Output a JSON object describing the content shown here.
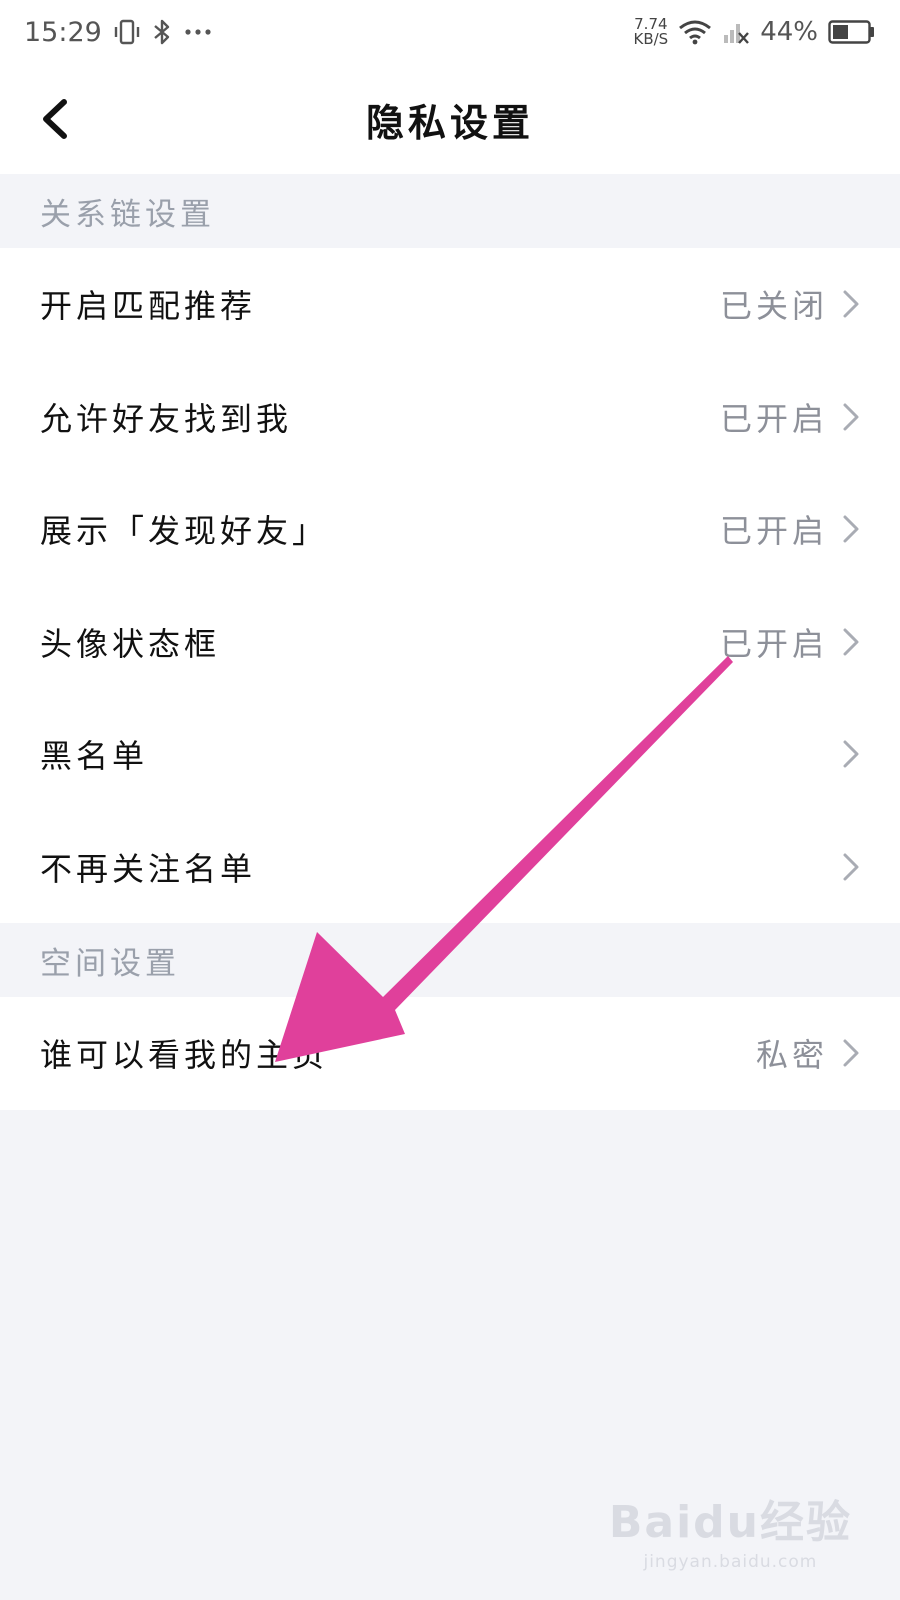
{
  "status_bar": {
    "time": "15:29",
    "net_speed_value": "7.74",
    "net_speed_unit": "KB/S",
    "battery": "44%",
    "icons": [
      "vibrate-icon",
      "bluetooth-icon",
      "more-dots-icon",
      "wifi-icon",
      "signal-off-icon",
      "battery-icon"
    ]
  },
  "header": {
    "title": "隐私设置"
  },
  "sections": [
    {
      "title": "关系链设置",
      "items": [
        {
          "label": "开启匹配推荐",
          "value": "已关闭"
        },
        {
          "label": "允许好友找到我",
          "value": "已开启"
        },
        {
          "label": "展示「发现好友」",
          "value": "已开启"
        },
        {
          "label": "头像状态框",
          "value": "已开启"
        },
        {
          "label": "黑名单",
          "value": ""
        },
        {
          "label": "不再关注名单",
          "value": ""
        }
      ]
    },
    {
      "title": "空间设置",
      "items": [
        {
          "label": "谁可以看我的主页",
          "value": "私密"
        }
      ]
    }
  ],
  "annotation": {
    "arrow_color": "#e0409b"
  },
  "watermark": {
    "logo": "Baidu经验",
    "url": "jingyan.baidu.com"
  }
}
